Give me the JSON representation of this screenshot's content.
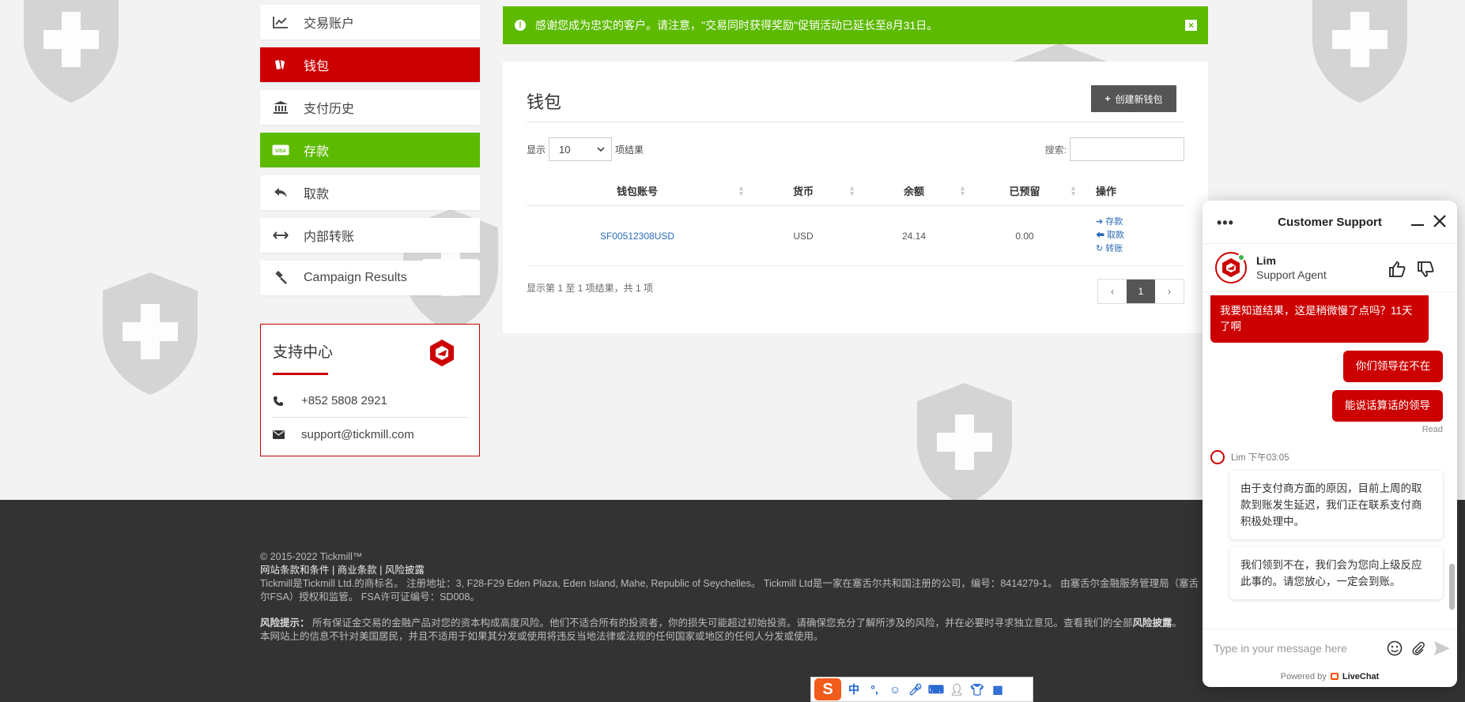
{
  "sidebar": {
    "items": [
      {
        "label": "交易账户",
        "icon": "chart-line-icon"
      },
      {
        "label": "钱包",
        "icon": "wallet-icon"
      },
      {
        "label": "支付历史",
        "icon": "bank-icon"
      },
      {
        "label": "存款",
        "icon": "visa-card-icon"
      },
      {
        "label": "取款",
        "icon": "reply-arrow-icon"
      },
      {
        "label": "内部转账",
        "icon": "arrows-horizontal-icon"
      },
      {
        "label": "Campaign Results",
        "icon": "gavel-icon"
      }
    ]
  },
  "support": {
    "title": "支持中心",
    "phone": "+852 5808 2921",
    "email": "support@tickmill.com"
  },
  "notice": {
    "text": "感谢您成为忠实的客户。请注意，\"交易同时获得奖励\"促销活动已延长至8月31日。",
    "close": "×"
  },
  "wallet": {
    "title": "钱包",
    "create_label": "创建新钱包",
    "show_label": "显示",
    "page_size": "10",
    "results_label": "项结果",
    "search_label": "搜索:",
    "columns": [
      "钱包账号",
      "货币",
      "余额",
      "已预留",
      "操作"
    ],
    "rows": [
      {
        "account": "SF00512308USD",
        "currency": "USD",
        "balance": "24.14",
        "reserved": "0.00",
        "actions": [
          "存款",
          "取款",
          "转账"
        ]
      }
    ],
    "info": "显示第 1 至 1 项结果，共 1 项",
    "pager": {
      "prev": "‹",
      "current": "1",
      "next": "›"
    }
  },
  "footer": {
    "copyright": "© 2015-2022 Tickmill™",
    "links": "网站条款和条件 | 商业条款 | 风险披露",
    "company": "Tickmill是Tickmill Ltd.的商标名。 注册地址：3, F28-F29 Eden Plaza, Eden Island, Mahe, Republic of Seychelles。 Tickmill Ltd是一家在塞舌尔共和国注册的公司，编号：8414279-1。 由塞舌尔金融服务管理局（塞舌尔FSA）授权和监管。 FSA许可证编号：SD008。",
    "risk_label": "风险提示：",
    "risk_text": "所有保证金交易的金融产品对您的资本构成高度风险。他们不适合所有的投资者，你的损失可能超过初始投资。请确保您充分了解所涉及的风险，并在必要时寻求独立意见。查看我们的全部",
    "risk_link": "风险披露",
    "risk_end": "。",
    "us_notice": "本网站上的信息不针对美国居民，并且不适用于如果其分发或使用将违反当地法律或法规的任何国家或地区的任何人分发或使用。"
  },
  "ime": {
    "logo": "S",
    "lang": "中",
    "punct": "°,"
  },
  "chat": {
    "title": "Customer Support",
    "agent_name": "Lim",
    "agent_role": "Support Agent",
    "messages_user": [
      "我要知道结果，这是稍微慢了点吗？11天了啊",
      "你们领导在不在",
      "能说话算话的领导"
    ],
    "read_label": "Read",
    "sender_line": "Lim 下午03:05",
    "messages_agent": [
      "由于支付商方面的原因，目前上周的取款到账发生延迟，我们正在联系支付商积极处理中。",
      "我们领到不在，我们会为您向上级反应此事的。请您放心，一定会到账。"
    ],
    "input_placeholder": "Type in your message here",
    "powered_by": "Powered by",
    "brand": "LiveChat"
  },
  "colors": {
    "brand_red": "#cc0000",
    "brand_green": "#5cba00",
    "footer_bg": "#333333",
    "link_blue": "#2a6ab8"
  }
}
